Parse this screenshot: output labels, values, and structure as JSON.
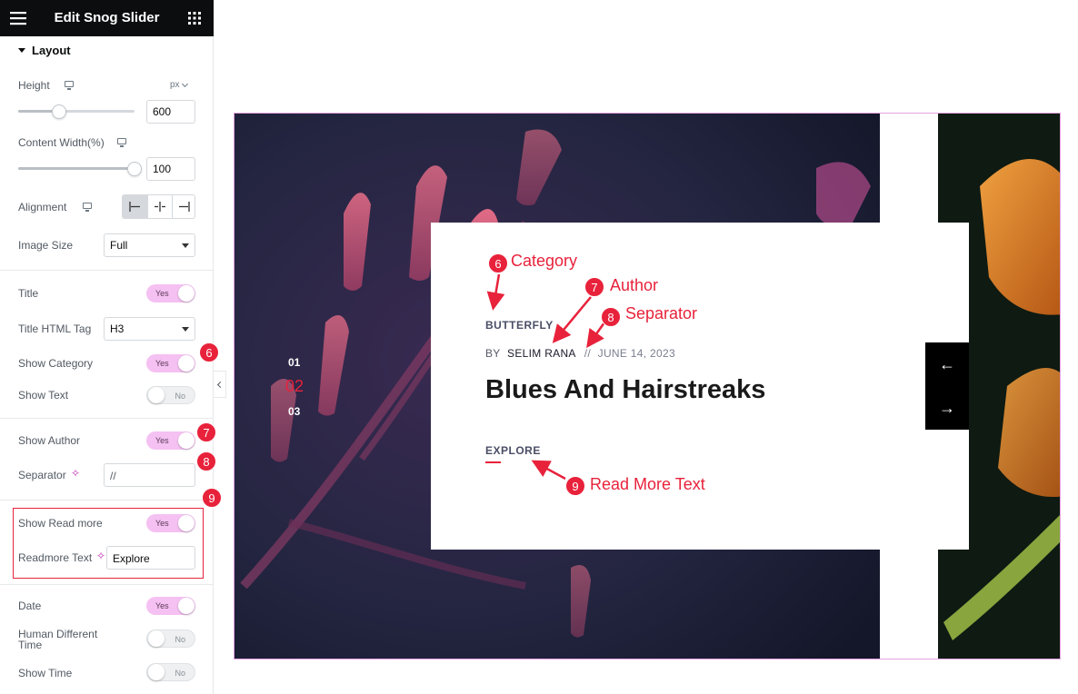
{
  "topbar": {
    "title": "Edit Snog Slider"
  },
  "panel": {
    "section_title": "Layout",
    "height": {
      "label": "Height",
      "unit": "px",
      "value": "600",
      "percent": 35
    },
    "content_width": {
      "label": "Content Width(%)",
      "value": "100",
      "percent": 100
    },
    "alignment": {
      "label": "Alignment",
      "options": [
        "left",
        "center",
        "right"
      ],
      "selected": "left"
    },
    "image_size": {
      "label": "Image Size",
      "value": "Full"
    },
    "title": {
      "label": "Title",
      "state": "Yes"
    },
    "title_tag": {
      "label": "Title HTML Tag",
      "value": "H3"
    },
    "show_category": {
      "label": "Show Category",
      "state": "Yes"
    },
    "show_text": {
      "label": "Show Text",
      "state": "No"
    },
    "show_author": {
      "label": "Show Author",
      "state": "Yes"
    },
    "separator": {
      "label": "Separator",
      "value": "//"
    },
    "show_readmore": {
      "label": "Show Read more",
      "state": "Yes"
    },
    "readmore_text": {
      "label": "Readmore Text",
      "value": "Explore"
    },
    "date": {
      "label": "Date",
      "state": "Yes"
    },
    "human_time": {
      "label1": "Human Different",
      "label2": "Time",
      "state": "No"
    },
    "show_time": {
      "label": "Show Time",
      "state": "No"
    }
  },
  "badges": {
    "b6": "6",
    "b7": "7",
    "b8": "8",
    "b9": "9"
  },
  "slide": {
    "category": "BUTTERFLY",
    "by": "BY",
    "author": "SELIM RANA",
    "separator": "//",
    "date": "JUNE 14, 2023",
    "title": "Blues And Hairstreaks",
    "read_more": "EXPLORE",
    "pagination": [
      "01",
      "02",
      "03"
    ],
    "active_page": "02"
  },
  "annotations": {
    "category": "Category",
    "author": "Author",
    "separator": "Separator",
    "read_more": "Read More Text"
  },
  "colors": {
    "accent": "#e8223b",
    "toggle_on": "#f5c1f2",
    "slider_border": "#e7a3e3"
  }
}
